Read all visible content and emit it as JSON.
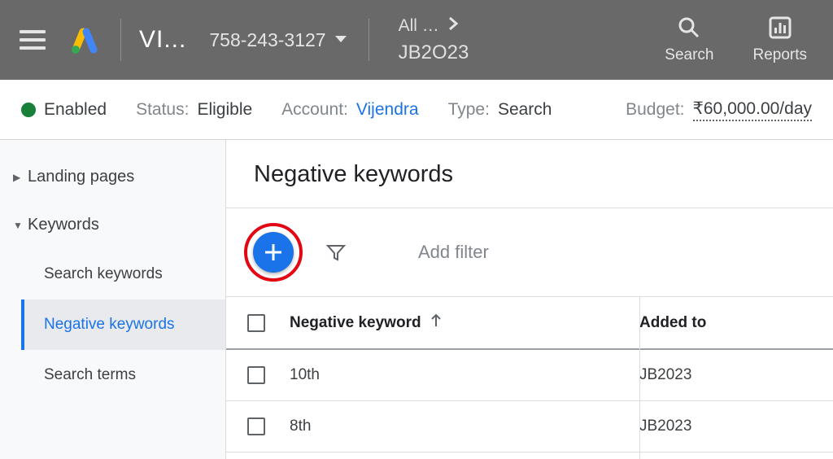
{
  "header": {
    "account_name": "VI...",
    "account_id": "758-243-3127",
    "breadcrumb_top": "All …",
    "breadcrumb_bottom": "JB2O23",
    "actions": {
      "search": "Search",
      "reports": "Reports"
    }
  },
  "status_bar": {
    "enabled_label": "Enabled",
    "status": {
      "label": "Status:",
      "value": "Eligible"
    },
    "account": {
      "label": "Account:",
      "value": "Vijendra"
    },
    "type": {
      "label": "Type:",
      "value": "Search"
    },
    "budget": {
      "label": "Budget:",
      "value": "₹60,000.00/day"
    }
  },
  "sidebar": {
    "items": [
      {
        "label": "Landing pages",
        "expanded": false
      },
      {
        "label": "Keywords",
        "expanded": true
      }
    ],
    "sub_items": [
      {
        "label": "Search keywords"
      },
      {
        "label": "Negative keywords"
      },
      {
        "label": "Search terms"
      }
    ]
  },
  "main": {
    "page_title": "Negative keywords",
    "add_filter_label": "Add filter",
    "table": {
      "columns": {
        "keyword": "Negative keyword",
        "added_to": "Added to"
      },
      "rows": [
        {
          "keyword": "10th",
          "added_to": "JB2023"
        },
        {
          "keyword": "8th",
          "added_to": "JB2023"
        }
      ]
    }
  }
}
